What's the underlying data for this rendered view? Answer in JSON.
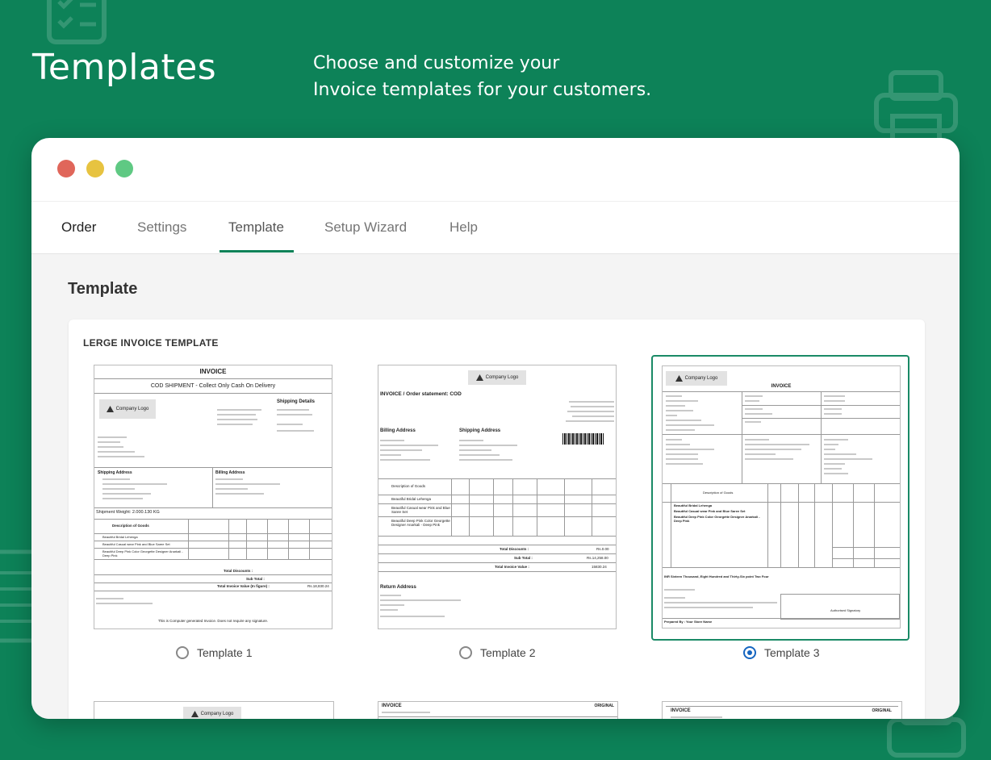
{
  "hero": {
    "title": "Templates",
    "subtitle_line1": "Choose and customize your",
    "subtitle_line2": "Invoice templates for your customers."
  },
  "tabs": [
    {
      "label": "Order"
    },
    {
      "label": "Settings"
    },
    {
      "label": "Template"
    },
    {
      "label": "Setup Wizard"
    },
    {
      "label": "Help"
    }
  ],
  "active_tab": "Template",
  "section_title": "Template",
  "card_label": "LERGE INVOICE TEMPLATE",
  "templates": [
    {
      "label": "Template 1",
      "selected": false,
      "preview": {
        "heading": "INVOICE",
        "banner": "COD SHIPMENT - Collect Only Cash On Delivery",
        "logo": "Company Logo",
        "shipping_details": "Shipping Details",
        "shipping_address": "Shipping Address",
        "billing_address": "Billing Address",
        "weight": "Shipment Weight: 2.000.130 KG",
        "desc_header": "Description of Goods",
        "items": [
          "Beautiful Bridal Lehenga",
          "Beautiful Casual wear Pink and Blue Saree Set",
          "Beautiful Deep Pink Color Georgette Designer Anarkali - Deep Pink"
        ],
        "total_discount": "Total Discounts :",
        "sub_total": "Sub Total :",
        "total_invoice": "Total Invoice Value (In figure) :",
        "total_invoice_amount": "Rs.18,830.24",
        "footer": "This is Computer generated Invoice. Does not require any signature."
      }
    },
    {
      "label": "Template 2",
      "selected": false,
      "preview": {
        "logo": "Company Logo",
        "heading": "INVOICE / Order statement: COD",
        "billing_address": "Billing Address",
        "shipping_address": "Shipping Address",
        "desc_header": "Description of Goods",
        "items": [
          "Beautiful Bridal Lehenga",
          "Beautiful Casual wear Pink and Blue Saree Set",
          "Beautiful Deep Pink Color Georgette Designer Anarkali - Deep Pink"
        ],
        "total_discount": "Total Discounts :",
        "discount_amount": "Rs.0.00",
        "sub_total": "Sub Total :",
        "sub_total_amount": "Rs.14,258.00",
        "total_invoice": "Total Invoice Value :",
        "total_invoice_amount": "15830.24",
        "return_address": "Return Address"
      }
    },
    {
      "label": "Template 3",
      "selected": true,
      "preview": {
        "logo": "Company Logo",
        "heading": "INVOICE",
        "desc_header": "Description of Goods",
        "items": [
          "Beautiful Bridal Lehenga",
          "Beautiful Casual wear Pink and Blue Saree Set",
          "Beautiful Deep Pink Color Georgette Designer Anarkali - Deep Pink"
        ],
        "amount_words": "INR Sixteen Thousand, Eight Hundred and Thirty-Six point Two Four",
        "signatory": "Authorised Signatory",
        "prepared_by": "Prepared By :   Your Store Name"
      }
    }
  ],
  "row2": [
    {
      "logo": "Company Logo"
    },
    {
      "heading": "INVOICE",
      "tag": "ORIGINAL"
    },
    {
      "heading": "INVOICE",
      "tag": "ORIGINAL"
    }
  ],
  "colors": {
    "background": "#0d8258",
    "accent": "#0d8258",
    "radio_selected": "#1565c0",
    "dot_red": "#e0665a",
    "dot_yellow": "#e7c340",
    "dot_green": "#5fc983"
  }
}
